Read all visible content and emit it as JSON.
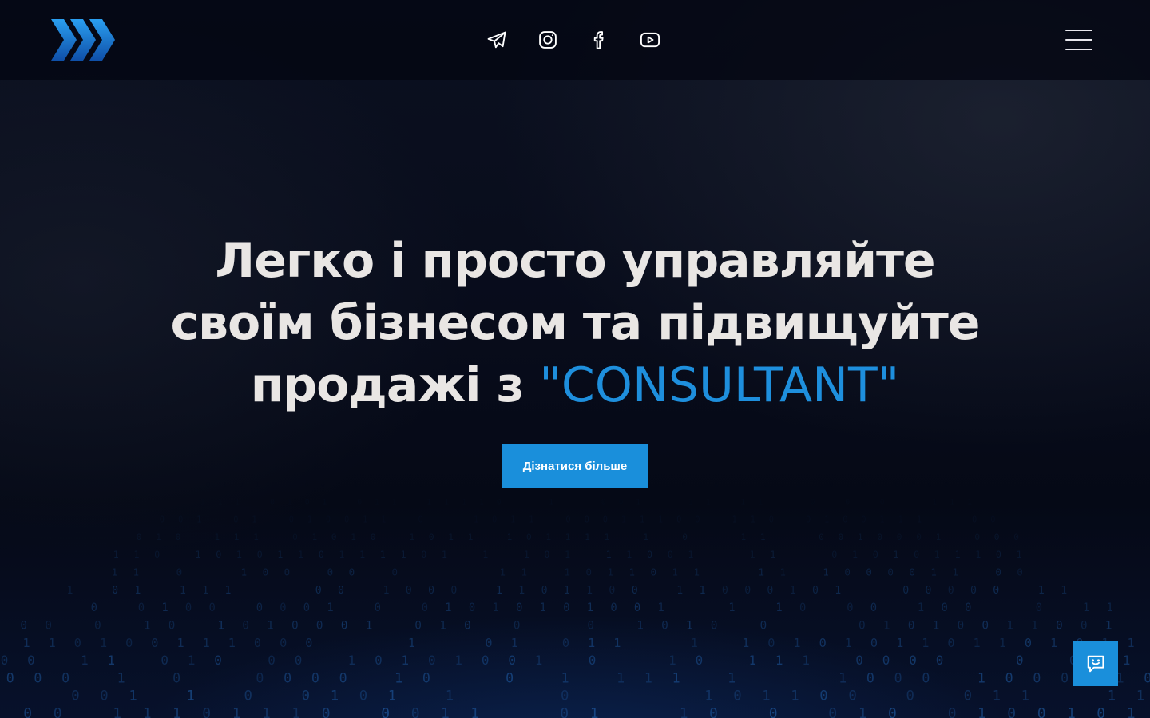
{
  "header": {
    "logo_icon": "chevron-arrows-logo",
    "social": [
      {
        "name": "telegram",
        "icon": "telegram-icon"
      },
      {
        "name": "instagram",
        "icon": "instagram-icon"
      },
      {
        "name": "facebook",
        "icon": "facebook-icon"
      },
      {
        "name": "youtube",
        "icon": "youtube-icon"
      }
    ],
    "menu_icon": "hamburger-menu-icon"
  },
  "hero": {
    "line1": "Легко і просто управляйте",
    "line2": "своїм бізнесом та підвищуйте",
    "line3_prefix": "продажі з ",
    "brand": "\"CONSULTANT\"",
    "cta_label": "Дізнатися більше"
  },
  "chat_widget": {
    "icon": "chat-smile-icon"
  },
  "colors": {
    "accent": "#1a8fdb",
    "background": "#070b18",
    "title_text": "#e9e6e4"
  }
}
